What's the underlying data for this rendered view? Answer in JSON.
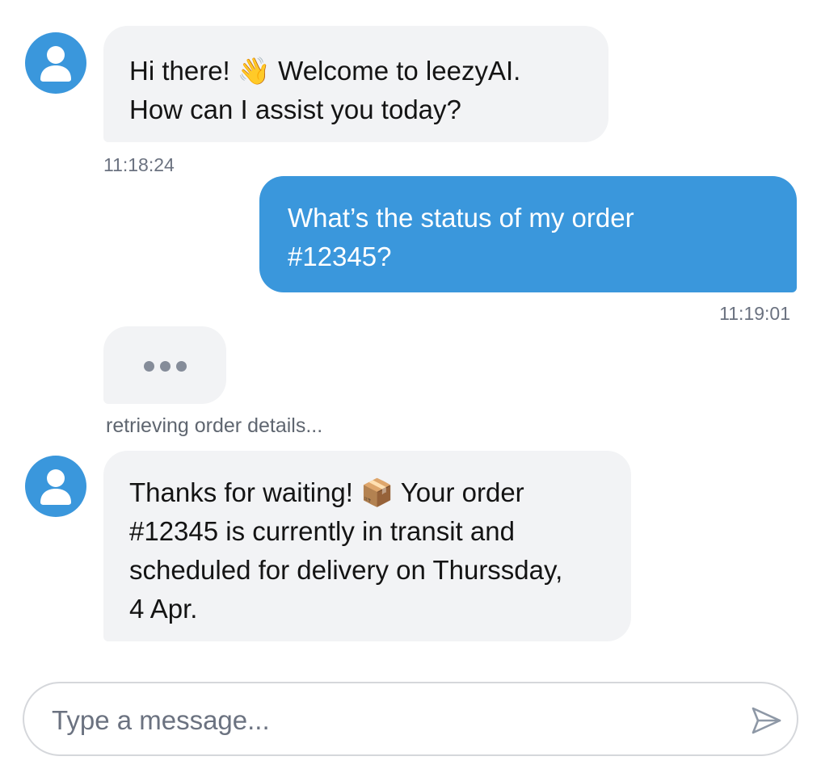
{
  "conversation": {
    "messages": [
      {
        "sender": "bot",
        "text": "Hi there! 👋 Welcome to leezyAI.\nHow can I assist you today?",
        "time": "11:18:24"
      },
      {
        "sender": "user",
        "text": "What’s the status of my order\n#12345?",
        "time": "11:19:01"
      },
      {
        "sender": "bot",
        "text": "Thanks for waiting! 📦 Your order\n#12345 is currently in transit and\nscheduled for delivery on Thurssday,\n4 Apr.",
        "time": ""
      }
    ],
    "typing_indicator": {
      "status_text": "retrieving order details..."
    }
  },
  "composer": {
    "placeholder": "Type a message..."
  },
  "icons": {
    "avatar": "user-avatar-icon",
    "send": "send-icon",
    "typing": "typing-dots-icon"
  },
  "colors": {
    "accent": "#3a97dc",
    "bot_bubble": "#f2f3f5",
    "timestamp": "#6b7280"
  }
}
